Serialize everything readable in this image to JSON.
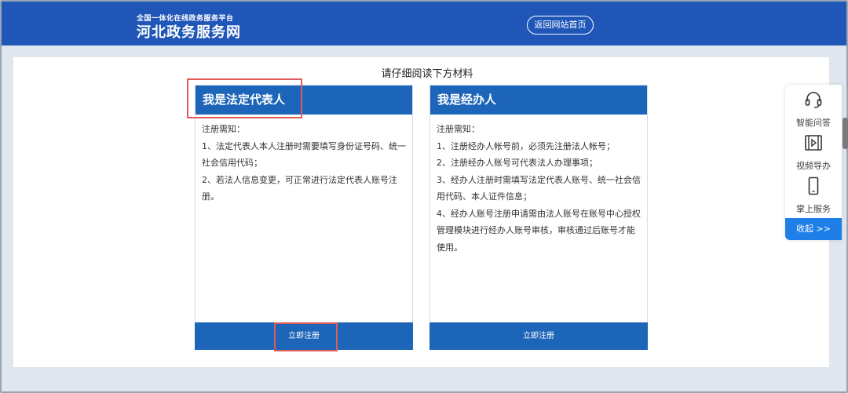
{
  "header": {
    "subtitle": "全国一体化在线政务服务平台",
    "title": "河北政务服务网",
    "home_button": "返回网站首页"
  },
  "main": {
    "instruction": "请仔细阅读下方材料",
    "cards": [
      {
        "title": "我是法定代表人",
        "notes_title": "注册需知：",
        "notes": [
          "1、法定代表人本人注册时需要填写身份证号码、统一社会信用代码；",
          "2、若法人信息变更，可正常进行法定代表人账号注册。"
        ],
        "button": "立即注册"
      },
      {
        "title": "我是经办人",
        "notes_title": "注册需知：",
        "notes": [
          "1、注册经办人帐号前，必须先注册法人帐号；",
          "2、注册经办人账号可代表法人办理事项；",
          "3、经办人注册时需填写法定代表人账号、统一社会信用代码、本人证件信息；",
          "4、经办人账号注册申请需由法人账号在账号中心授权管理模块进行经办人账号审核，审核通过后账号才能使用。"
        ],
        "button": "立即注册"
      }
    ]
  },
  "sidebar": {
    "items": [
      {
        "icon": "headset-icon",
        "label": "智能问答"
      },
      {
        "icon": "video-icon",
        "label": "视频导办"
      },
      {
        "icon": "mobile-icon",
        "label": "掌上服务"
      }
    ],
    "collapse": "收起 >>"
  },
  "colors": {
    "header_bg": "#1f56b8",
    "card_head_bg": "#1d65b9",
    "highlight": "#e05a5a",
    "collapse_bg": "#1f7fe8"
  }
}
